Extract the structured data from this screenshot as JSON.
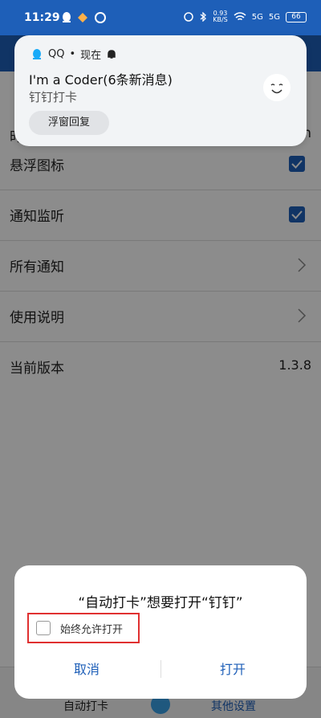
{
  "status_bar": {
    "time": "11:29",
    "network_speed": "0.93",
    "network_speed_unit": "KB/S",
    "signal_1": "5G",
    "signal_2": "5G",
    "battery": "66"
  },
  "app": {
    "partial_left_char": "时",
    "partial_right_char": "in",
    "rows": [
      {
        "label": "悬浮图标",
        "control": "checkbox",
        "checked": true
      },
      {
        "label": "通知监听",
        "control": "checkbox",
        "checked": true
      },
      {
        "label": "所有通知",
        "control": "chevron"
      },
      {
        "label": "使用说明",
        "control": "chevron"
      },
      {
        "label": "当前版本",
        "control": "value",
        "value": "1.3.8"
      }
    ],
    "bottom_nav": {
      "left_label": "自动打卡",
      "right_label": "其他设置"
    }
  },
  "notification": {
    "app_name": "QQ",
    "separator": "•",
    "time": "现在",
    "title": "I'm a Coder(6条新消息)",
    "body": "钉钉打卡",
    "action_label": "浮窗回复"
  },
  "dialog": {
    "title": "“自动打卡”想要打开“钉钉”",
    "remember_label": "始终允许打开",
    "remember_checked": false,
    "cancel_label": "取消",
    "open_label": "打开"
  },
  "colors": {
    "brand_blue": "#1e5fb8",
    "highlight_red": "#e03030"
  }
}
